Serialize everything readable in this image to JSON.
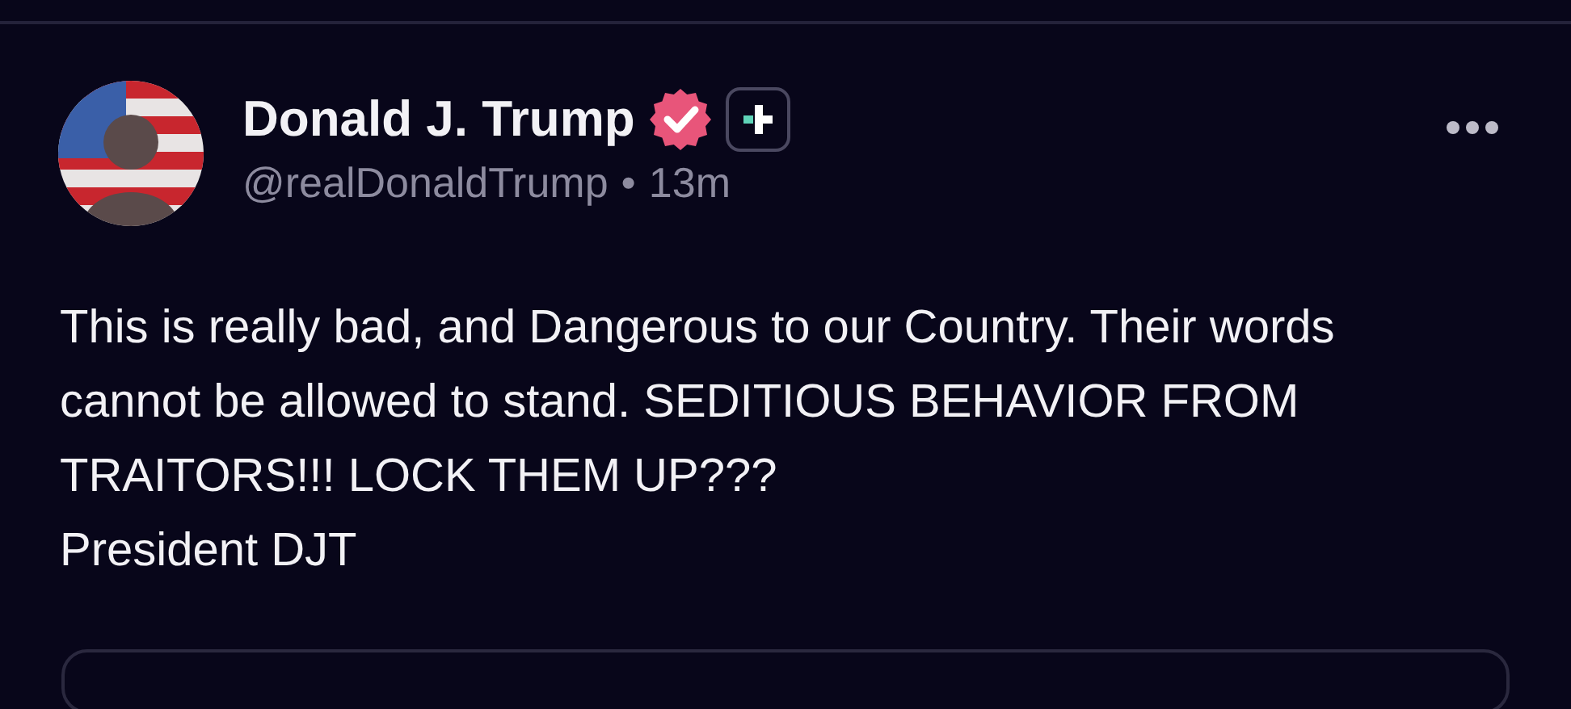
{
  "post": {
    "author": "Donald J. Trump",
    "verified": true,
    "handle": "@realDonaldTrump",
    "separator": "•",
    "time": "13m",
    "text": "This is really bad, and Dangerous to our Country. Their words cannot be allowed to stand. SEDITIOUS BEHAVIOR FROM TRAITORS!!! LOCK THEM UP???\nPresident DJT"
  }
}
